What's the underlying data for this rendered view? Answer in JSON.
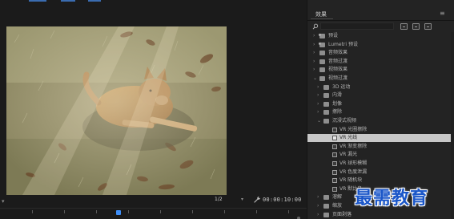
{
  "monitor": {
    "quality": {
      "value": "1/2",
      "dropdown_icon": "chevron-down-icon"
    },
    "fit_dropdown_icon": "chevron-down-icon",
    "timecode": "00:00:10:00",
    "settings_icon": "wrench-icon"
  },
  "panel": {
    "title": "效果",
    "menu_icon": "≡",
    "search": {
      "value": "",
      "placeholder": "",
      "icon": "search-icon"
    },
    "filter_buttons": [
      "accelerated-effects-icon",
      "32bit-color-icon",
      "yuv-effects-icon"
    ],
    "tree": [
      {
        "depth": 0,
        "type": "folder",
        "starred": true,
        "label": "预设",
        "expanded": false
      },
      {
        "depth": 0,
        "type": "folder",
        "starred": true,
        "label": "Lumetri 预设",
        "expanded": false
      },
      {
        "depth": 0,
        "type": "folder",
        "starred": false,
        "label": "音频效果",
        "expanded": false
      },
      {
        "depth": 0,
        "type": "folder",
        "starred": false,
        "label": "音频过渡",
        "expanded": false
      },
      {
        "depth": 0,
        "type": "folder",
        "starred": false,
        "label": "视频效果",
        "expanded": false
      },
      {
        "depth": 0,
        "type": "folder",
        "starred": false,
        "label": "视频过渡",
        "expanded": true
      },
      {
        "depth": 1,
        "type": "folder",
        "label": "3D 运动",
        "expanded": false
      },
      {
        "depth": 1,
        "type": "folder",
        "label": "内滑",
        "expanded": false
      },
      {
        "depth": 1,
        "type": "folder",
        "label": "划像",
        "expanded": false
      },
      {
        "depth": 1,
        "type": "folder",
        "label": "擦除",
        "expanded": false
      },
      {
        "depth": 1,
        "type": "folder",
        "label": "沉浸式视频",
        "expanded": true
      },
      {
        "depth": 2,
        "type": "effect",
        "label": "VR 光圈擦除",
        "selected": false
      },
      {
        "depth": 2,
        "type": "effect",
        "label": "VR 光线",
        "selected": true
      },
      {
        "depth": 2,
        "type": "effect",
        "label": "VR 渐变擦除",
        "selected": false
      },
      {
        "depth": 2,
        "type": "effect",
        "label": "VR 漏光",
        "selected": false
      },
      {
        "depth": 2,
        "type": "effect",
        "label": "VR 球形模糊",
        "selected": false
      },
      {
        "depth": 2,
        "type": "effect",
        "label": "VR 色度泄漏",
        "selected": false
      },
      {
        "depth": 2,
        "type": "effect",
        "label": "VR 随机块",
        "selected": false
      },
      {
        "depth": 2,
        "type": "effect",
        "label": "VR 默比乌",
        "selected": false
      },
      {
        "depth": 1,
        "type": "folder",
        "label": "溶解",
        "expanded": false
      },
      {
        "depth": 1,
        "type": "folder",
        "label": "缩放",
        "expanded": false
      },
      {
        "depth": 1,
        "type": "folder",
        "label": "页面剥落",
        "expanded": false
      }
    ]
  },
  "watermark": {
    "text": "最需教育"
  },
  "colors": {
    "accent": "#3e8ef7",
    "panel_bg": "#232323",
    "monitor_bg": "#1b1b1b",
    "selected_row": "#c7c7c7",
    "watermark": "#1a56c8"
  }
}
